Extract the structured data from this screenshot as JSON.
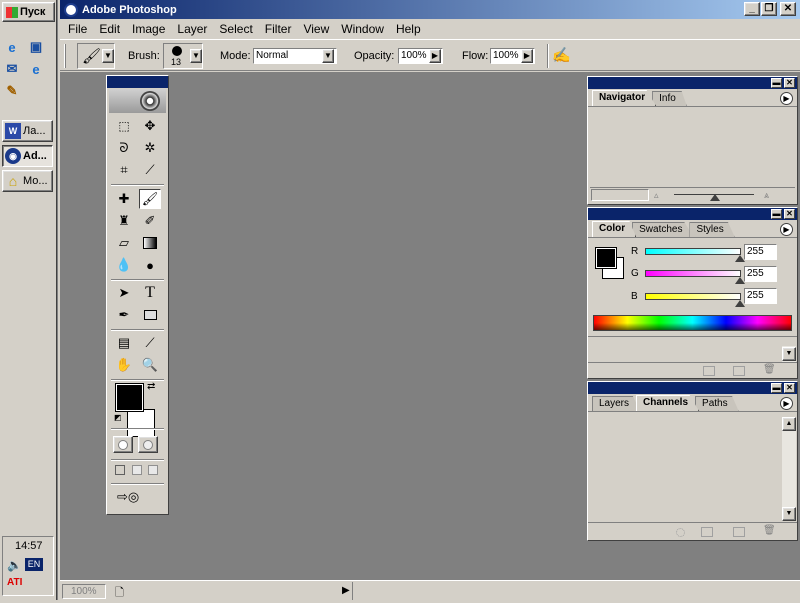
{
  "taskbar": {
    "start_label": "Пуск",
    "quick_launch": [
      "ie-icon",
      "desktop-icon",
      "outlook-icon",
      "ie2-icon",
      "channel-icon"
    ],
    "tasks": [
      {
        "label": "Ла...",
        "icon": "word-icon",
        "active": false
      },
      {
        "label": "Ad...",
        "icon": "photoshop-icon",
        "active": true
      },
      {
        "label": "Мо...",
        "icon": "folder-icon",
        "active": false
      }
    ],
    "tray": {
      "time": "14:57",
      "lang": "EN"
    }
  },
  "window": {
    "title": "Adobe Photoshop",
    "menu": [
      "File",
      "Edit",
      "Image",
      "Layer",
      "Select",
      "Filter",
      "View",
      "Window",
      "Help"
    ]
  },
  "options": {
    "brush_label": "Brush:",
    "brush_size": "13",
    "mode_label": "Mode:",
    "mode_value": "Normal",
    "opacity_label": "Opacity:",
    "opacity_value": "100%",
    "flow_label": "Flow:",
    "flow_value": "100%"
  },
  "status": {
    "zoom": "100%"
  },
  "navigator": {
    "tabs": [
      "Navigator",
      "Info"
    ]
  },
  "color": {
    "tabs": [
      "Color",
      "Swatches",
      "Styles"
    ],
    "channels": [
      {
        "label": "R",
        "value": "255",
        "gradient": "#00ffff"
      },
      {
        "label": "G",
        "value": "255",
        "gradient": "#ff00ff"
      },
      {
        "label": "B",
        "value": "255",
        "gradient": "#ffff00"
      }
    ]
  },
  "layers": {
    "tabs": [
      "Layers",
      "Channels",
      "Paths"
    ]
  },
  "colors": {
    "title_bar": "#0a246a",
    "workspace": "#808080",
    "face": "#d4d0c8"
  }
}
